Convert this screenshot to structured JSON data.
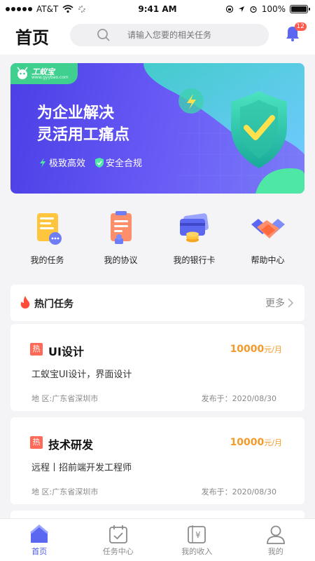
{
  "status_bar": {
    "carrier": "AT&T",
    "time": "9:41 AM",
    "battery": "100%"
  },
  "header": {
    "title": "首页",
    "search_placeholder": "请输入您要的相关任务",
    "notification_count": "12"
  },
  "banner": {
    "logo_text": "工蚁宝",
    "logo_url": "www.gyybao.com",
    "title_line1": "为企业解决",
    "title_line2": "灵活用工痛点",
    "tag1": "极致高效",
    "tag2": "安全合规"
  },
  "actions": [
    {
      "label": "我的任务"
    },
    {
      "label": "我的协议"
    },
    {
      "label": "我的银行卡"
    },
    {
      "label": "帮助中心"
    }
  ],
  "hot": {
    "title": "热门任务",
    "more": "更多"
  },
  "tasks": [
    {
      "badge": "热",
      "title": "UI设计",
      "salary": "10000",
      "salary_unit": "元/月",
      "desc": "工蚁宝UI设计，界面设计",
      "location": "地  区:广东省深圳市",
      "published": "发布于：2020/08/30"
    },
    {
      "badge": "热",
      "title": "技术研发",
      "salary": "10000",
      "salary_unit": "元/月",
      "desc": "远程丨招前端开发工程师",
      "location": "地  区:广东省深圳市",
      "published": "发布于：2020/08/30"
    }
  ],
  "tabs": [
    {
      "label": "首页",
      "active": true
    },
    {
      "label": "任务中心"
    },
    {
      "label": "我的收入"
    },
    {
      "label": "我的"
    }
  ],
  "colors": {
    "accent": "#4a58e8",
    "salary": "#f39a2a",
    "hot": "#ff6a58"
  }
}
